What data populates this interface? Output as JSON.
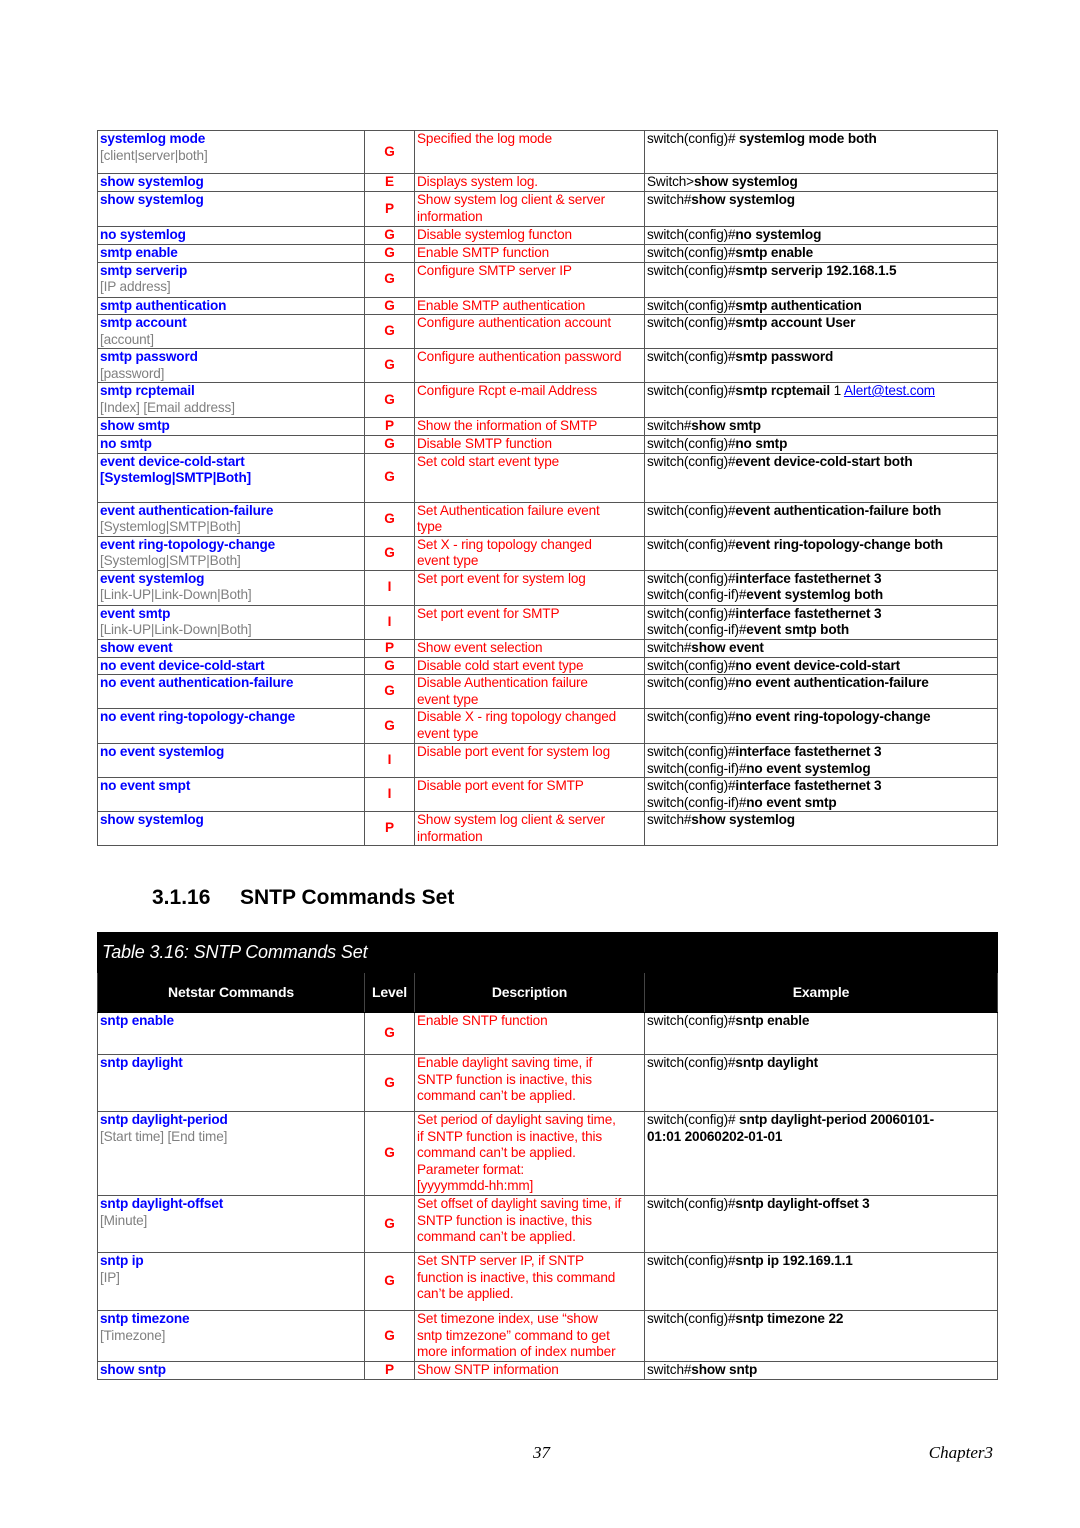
{
  "colors": {
    "command": "#0000ff",
    "parameter": "#808080",
    "level": "#ff0000",
    "description": "#ff0000",
    "example": "#000000",
    "header_bg": "#000000"
  },
  "table1": {
    "rows": [
      {
        "cmd": "systemlog mode",
        "param": "[client|server|both]",
        "level": "G",
        "desc": [
          "Specified the log mode"
        ],
        "ex": [
          {
            "p": "switch(config)#",
            "b": " systemlog mode both"
          }
        ]
      },
      {
        "cmd": "show systemlog",
        "level": "E",
        "desc": [
          "Displays system log."
        ],
        "ex": [
          {
            "p": "Switch>",
            "b": "show systemlog"
          }
        ]
      },
      {
        "cmd": "show systemlog",
        "level": "P",
        "desc": [
          "Show system log client & server",
          "information"
        ],
        "ex": [
          {
            "p": "switch#",
            "b": "show systemlog"
          }
        ]
      },
      {
        "cmd": "no systemlog",
        "level": "G",
        "desc": [
          "Disable systemlog functon"
        ],
        "ex": [
          {
            "p": "switch(config)#",
            "b": "no systemlog"
          }
        ]
      },
      {
        "cmd": "smtp enable",
        "level": "G",
        "desc": [
          "Enable SMTP function"
        ],
        "ex": [
          {
            "p": "switch(config)#",
            "b": "smtp enable"
          }
        ]
      },
      {
        "cmd": "smtp serverip",
        "param": "[IP address]",
        "level": "G",
        "desc": [
          "Configure SMTP server IP"
        ],
        "ex": [
          {
            "p": "switch(config)#",
            "b": "smtp serverip 192.168.1.5"
          }
        ]
      },
      {
        "cmd": "smtp authentication",
        "level": "G",
        "desc": [
          "Enable SMTP authentication"
        ],
        "ex": [
          {
            "p": "switch(config)#",
            "b": "smtp authentication"
          }
        ]
      },
      {
        "cmd": "smtp account",
        "param": "[account]",
        "level": "G",
        "desc": [
          "Configure authentication account"
        ],
        "ex": [
          {
            "p": "switch(config)#",
            "b": "smtp account User"
          }
        ]
      },
      {
        "cmd": "smtp password",
        "param": "[password]",
        "level": "G",
        "desc": [
          "Configure authentication password"
        ],
        "ex": [
          {
            "p": "switch(config)#",
            "b": "smtp password"
          }
        ]
      },
      {
        "cmd": "smtp rcptemail",
        "param": "[Index] [Email address]",
        "level": "G",
        "desc": [
          "Configure Rcpt e-mail Address"
        ],
        "ex": [
          {
            "p": "switch(config)#",
            "b": "smtp rcptemail ",
            "n": "1 ",
            "link": "Alert@test.com"
          }
        ]
      },
      {
        "cmd": "show smtp",
        "level": "P",
        "desc": [
          "Show the information of SMTP"
        ],
        "ex": [
          {
            "p": "switch#",
            "b": "show smtp"
          }
        ]
      },
      {
        "cmd": "no smtp",
        "level": "G",
        "desc": [
          "Disable SMTP function"
        ],
        "ex": [
          {
            "p": "switch(config)#",
            "b": "no smtp"
          }
        ]
      },
      {
        "cmd": "event device-cold-start",
        "param": "[Systemlog|SMTP|Both]",
        "param_strong": true,
        "level": "G",
        "desc": [
          "Set cold start event type"
        ],
        "ex": [
          {
            "p": "switch(config)#",
            "b": "event device-cold-start both"
          }
        ]
      },
      {
        "cmd": "event authentication-failure",
        "param": "[Systemlog|SMTP|Both]",
        "level": "G",
        "desc": [
          "Set Authentication failure event",
          "type"
        ],
        "ex": [
          {
            "p": "switch(config)#",
            "b": "event authentication-failure both"
          }
        ]
      },
      {
        "cmd": "event ring-topology-change",
        "param": "[Systemlog|SMTP|Both]",
        "level": "G",
        "desc": [
          "Set X -  ring topology changed",
          "event type"
        ],
        "ex": [
          {
            "p": "switch(config)#",
            "b": "event ring-topology-change both"
          }
        ]
      },
      {
        "cmd": "event systemlog",
        "param": "[Link-UP|Link-Down|Both]",
        "level": "I",
        "desc": [
          "Set port event for system log"
        ],
        "ex": [
          {
            "p": "switch(config)#",
            "b": "interface fastethernet 3"
          },
          {
            "p": "switch(config-if)#",
            "b": "event systemlog both"
          }
        ]
      },
      {
        "cmd": "event smtp",
        "param": "[Link-UP|Link-Down|Both]",
        "level": "I",
        "desc": [
          "Set port event for SMTP"
        ],
        "ex": [
          {
            "p": "switch(config)#",
            "b": "interface fastethernet 3"
          },
          {
            "p": "switch(config-if)#",
            "b": "event smtp both"
          }
        ]
      },
      {
        "cmd": "show event",
        "level": "P",
        "desc": [
          "Show event selection"
        ],
        "ex": [
          {
            "p": "switch#",
            "b": "show event"
          }
        ]
      },
      {
        "cmd": "no event device-cold-start",
        "level": "G",
        "desc": [
          "Disable cold start event type"
        ],
        "ex": [
          {
            "p": "switch(config)#",
            "b": "no event device-cold-start"
          }
        ]
      },
      {
        "cmd": "no event authentication-failure",
        "level": "G",
        "desc": [
          "Disable Authentication failure",
          "event type"
        ],
        "ex": [
          {
            "p": "switch(config)#",
            "b": "no event authentication-failure"
          }
        ]
      },
      {
        "cmd": "no event ring-topology-change",
        "level": "G",
        "desc": [
          "Disable X -  ring topology changed",
          "event type"
        ],
        "ex": [
          {
            "p": "switch(config)#",
            "b": "no event ring-topology-change"
          }
        ]
      },
      {
        "cmd": "no event systemlog",
        "level": "I",
        "desc": [
          "Disable port event for system log"
        ],
        "ex": [
          {
            "p": "switch(config)#",
            "b": "interface fastethernet 3"
          },
          {
            "p": "switch(config-if)#",
            "b": "no event systemlog"
          }
        ]
      },
      {
        "cmd": "no event smpt",
        "level": "I",
        "desc": [
          "Disable port event for SMTP"
        ],
        "ex": [
          {
            "p": "switch(config)#",
            "b": "interface fastethernet 3"
          },
          {
            "p": "switch(config-if)#",
            "b": "no event smtp"
          }
        ]
      },
      {
        "cmd": "show systemlog",
        "level": "P",
        "desc": [
          "Show system log client & server",
          "information"
        ],
        "ex": [
          {
            "p": "switch#",
            "b": "show systemlog"
          }
        ]
      }
    ]
  },
  "section": {
    "number": "3.1.16",
    "title": "SNTP Commands Set"
  },
  "table2": {
    "caption": "Table 3.16: SNTP Commands Set",
    "headers": [
      "Netstar Commands",
      "Level",
      "Description",
      "Example"
    ],
    "rows": [
      {
        "cmd": "sntp enable",
        "level": "G",
        "desc": [
          "Enable SNTP function"
        ],
        "ex": [
          {
            "p": "switch(config)#",
            "b": "sntp enable"
          }
        ]
      },
      {
        "cmd": "sntp daylight",
        "level": "G",
        "desc": [
          "Enable daylight saving time, if",
          "SNTP function is inactive, this",
          "command can’t be applied."
        ],
        "ex": [
          {
            "p": "switch(config)#",
            "b": "sntp daylight"
          }
        ]
      },
      {
        "cmd": "sntp daylight-period",
        "param": "[Start time] [End time]",
        "level": "G",
        "desc": [
          "Set period of daylight saving time,",
          "if SNTP function is inactive, this",
          "command can’t be applied.",
          "Parameter format:",
          "[yyyymmdd-hh:mm]"
        ],
        "ex": [
          {
            "p": "switch(config)#",
            "b": " sntp daylight-period 20060101-"
          },
          {
            "p": "",
            "b": "01:01 20060202-01-01"
          }
        ]
      },
      {
        "cmd": "sntp daylight-offset",
        "param": "[Minute]",
        "level": "G",
        "desc": [
          "Set offset of daylight saving time, if",
          "SNTP function is inactive, this",
          "command can’t be applied."
        ],
        "ex": [
          {
            "p": "switch(config)#",
            "b": "sntp daylight-offset 3"
          }
        ]
      },
      {
        "cmd": "sntp ip",
        "param": "[IP]",
        "level": "G",
        "desc": [
          "Set SNTP server IP, if SNTP",
          "function is inactive, this command",
          "can’t be applied."
        ],
        "ex": [
          {
            "p": "switch(config)#",
            "b": "sntp ip 192.169.1.1"
          }
        ]
      },
      {
        "cmd": "sntp timezone",
        "param": "[Timezone]",
        "level": "G",
        "desc": [
          "Set timezone index, use “show",
          "sntp timzezone” command to get",
          "more information of index number"
        ],
        "ex": [
          {
            "p": "switch(config)#",
            "b": "sntp timezone 22"
          }
        ]
      },
      {
        "cmd": "show sntp",
        "level": "P",
        "desc": [
          "Show SNTP information"
        ],
        "ex": [
          {
            "p": "switch#",
            "b": "show sntp"
          }
        ]
      }
    ]
  },
  "footer": {
    "page": "37",
    "chapter": "Chapter3"
  }
}
